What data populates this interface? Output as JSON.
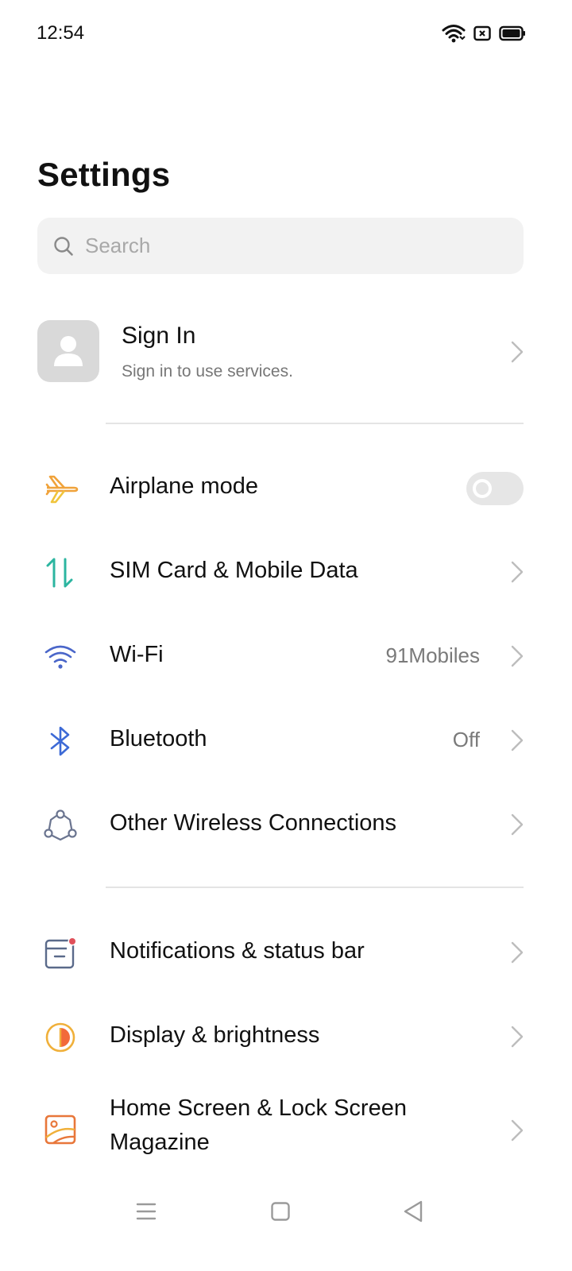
{
  "status_bar": {
    "time": "12:54",
    "icons": [
      "wifi-icon",
      "sim-off-icon",
      "battery-icon"
    ]
  },
  "page": {
    "title": "Settings"
  },
  "search": {
    "placeholder": "Search",
    "value": ""
  },
  "account": {
    "title": "Sign In",
    "subtitle": "Sign in to use services."
  },
  "settings": {
    "airplane": {
      "label": "Airplane mode",
      "enabled": false,
      "icon": "airplane-icon",
      "color": "#f0a23a"
    },
    "sim": {
      "label": "SIM Card & Mobile Data",
      "icon": "data-arrows-icon",
      "color": "#2cb5a0"
    },
    "wifi": {
      "label": "Wi-Fi",
      "value": "91Mobiles",
      "icon": "wifi-icon",
      "color": "#4a66c9"
    },
    "bluetooth": {
      "label": "Bluetooth",
      "value": "Off",
      "icon": "bluetooth-icon",
      "color": "#3d6ad6"
    },
    "wireless": {
      "label": "Other Wireless Connections",
      "icon": "connections-icon",
      "color": "#6b7590"
    },
    "notifications": {
      "label": "Notifications & status bar",
      "icon": "notification-icon",
      "color": "#5a6a8a"
    },
    "display": {
      "label": "Display & brightness",
      "icon": "brightness-icon",
      "color": "#f28c3b"
    },
    "home": {
      "label": "Home Screen & Lock Screen Magazine",
      "icon": "wallpaper-icon",
      "color": "#e8773a"
    }
  },
  "nav_bar": {
    "icons": [
      "menu-icon",
      "home-icon",
      "back-icon"
    ]
  }
}
